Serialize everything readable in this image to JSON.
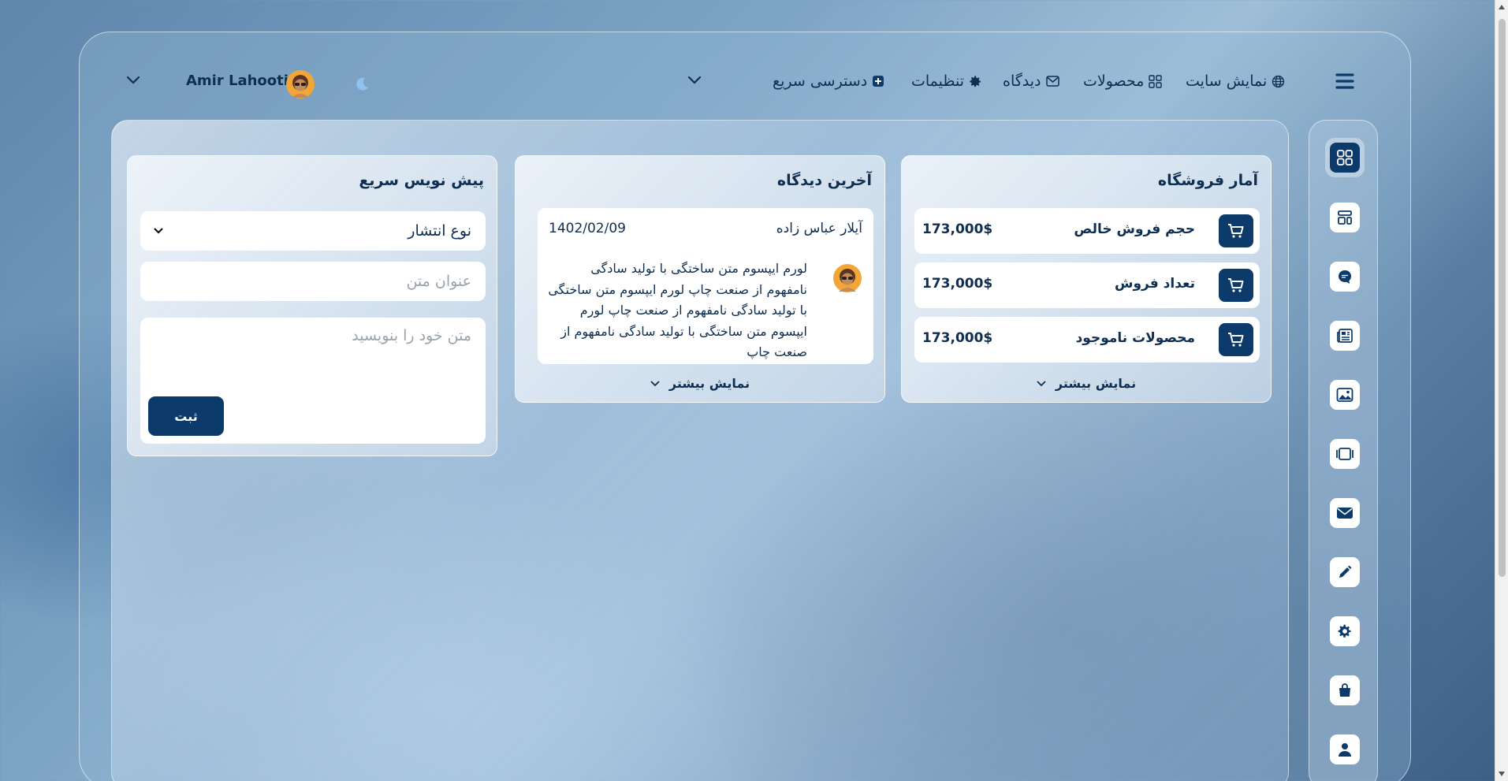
{
  "header": {
    "user_name": "Amir Lahooti",
    "quick_access_label": "دسترسی سریع",
    "nav": [
      {
        "label": "تنظیمات",
        "icon": "gear-icon"
      },
      {
        "label": "دیدگاه",
        "icon": "envelope-icon"
      },
      {
        "label": "محصولات",
        "icon": "grid-icon"
      },
      {
        "label": "نمایش سایت",
        "icon": "globe-icon"
      }
    ]
  },
  "sidebar": {
    "items": [
      {
        "icon": "dashboard-icon",
        "active": true
      },
      {
        "icon": "layout-icon"
      },
      {
        "icon": "chat-icon"
      },
      {
        "icon": "newspaper-icon"
      },
      {
        "icon": "image-icon"
      },
      {
        "icon": "film-icon"
      },
      {
        "icon": "mail-icon"
      },
      {
        "icon": "pencil-icon"
      },
      {
        "icon": "gear-icon"
      },
      {
        "icon": "bag-icon"
      },
      {
        "icon": "user-icon"
      }
    ]
  },
  "store_stats": {
    "title": "آمار فروشگاه",
    "rows": [
      {
        "label": "حجم فروش خالص",
        "value": "173,000$"
      },
      {
        "label": "تعداد فروش",
        "value": "173,000$"
      },
      {
        "label": "محصولات ناموجود",
        "value": "173,000$"
      }
    ],
    "more_label": "نمایش بیشتر"
  },
  "latest_reviews": {
    "title": "آخرین دیدگاه",
    "review": {
      "author": "آیلار عباس زاده",
      "date": "1402/02/09",
      "text": "لورم ایپسوم متن ساختگی با تولید سادگی نامفهوم از صنعت چاپ لورم ایپسوم متن ساختگی با تولید سادگی نامفهوم از صنعت چاپ لورم ایپسوم متن ساختگی با تولید سادگی نامفهوم از صنعت چاپ"
    },
    "more_label": "نمایش بیشتر"
  },
  "quick_draft": {
    "title": "پیش نویس سریع",
    "publish_type": "نوع انتشار",
    "title_placeholder": "عنوان متن",
    "body_placeholder": "متن خود را بنویسید",
    "submit_label": "ثبت"
  },
  "colors": {
    "primary": "#0c3a6b",
    "text": "#0e2f52",
    "placeholder": "#9aa3ad",
    "accent_moon": "#8fc2f2"
  }
}
